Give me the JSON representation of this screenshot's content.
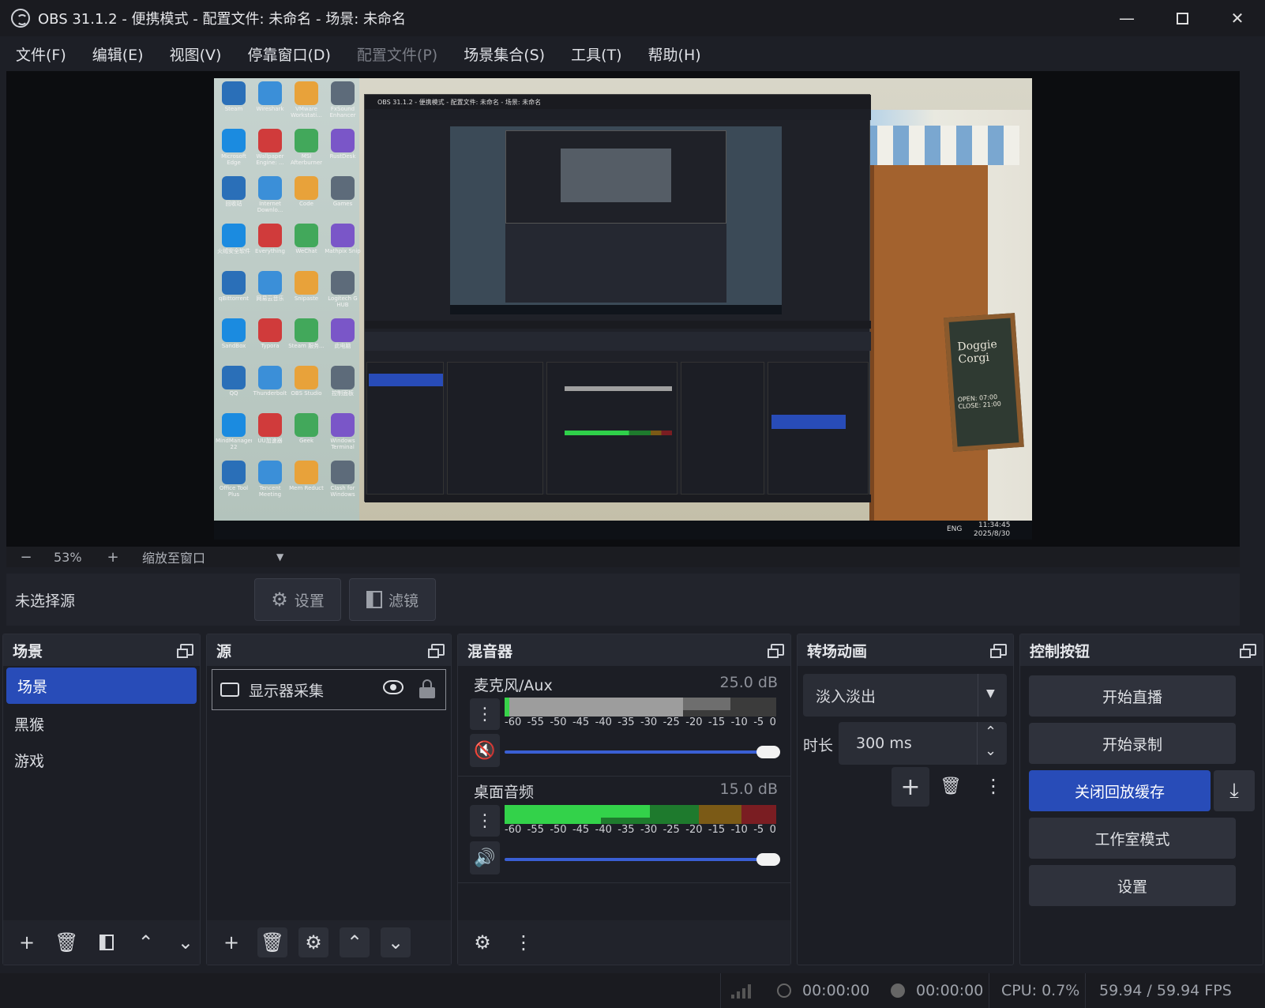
{
  "window": {
    "title": "OBS 31.1.2 - 便携模式 - 配置文件: 未命名 - 场景: 未命名"
  },
  "menu": [
    {
      "label": "文件(F)",
      "enabled": true
    },
    {
      "label": "编辑(E)",
      "enabled": true
    },
    {
      "label": "视图(V)",
      "enabled": true
    },
    {
      "label": "停靠窗口(D)",
      "enabled": true
    },
    {
      "label": "配置文件(P)",
      "enabled": false
    },
    {
      "label": "场景集合(S)",
      "enabled": true
    },
    {
      "label": "工具(T)",
      "enabled": true
    },
    {
      "label": "帮助(H)",
      "enabled": true
    }
  ],
  "zoom": {
    "minus": "−",
    "value": "53%",
    "plus": "+",
    "mode": "缩放至窗口"
  },
  "context": {
    "no_source": "未选择源",
    "settings_label": "设置",
    "filters_label": "滤镜"
  },
  "scenes": {
    "title": "场景",
    "items": [
      "场景",
      "黑猴",
      "游戏"
    ],
    "selected_index": 0
  },
  "sources": {
    "title": "源",
    "items": [
      {
        "name": "显示器采集",
        "visible": true,
        "locked": true
      }
    ]
  },
  "mixer": {
    "title": "混音器",
    "scale_labels": [
      "-60",
      "-55",
      "-50",
      "-45",
      "-40",
      "-35",
      "-30",
      "-25",
      "-20",
      "-15",
      "-10",
      "-5",
      "0"
    ],
    "channels": [
      {
        "name": "麦克风/Aux",
        "db": "25.0 dB",
        "muted": true,
        "volume_fraction": 1.0
      },
      {
        "name": "桌面音频",
        "db": "15.0 dB",
        "muted": false,
        "volume_fraction": 1.0
      }
    ]
  },
  "transitions": {
    "title": "转场动画",
    "selected": "淡入淡出",
    "duration_label": "时长",
    "duration_value": "300 ms"
  },
  "controls": {
    "title": "控制按钮",
    "start_stream": "开始直播",
    "start_record": "开始录制",
    "replay_buffer": "关闭回放缓存",
    "studio_mode": "工作室模式",
    "settings": "设置"
  },
  "status": {
    "stream_time": "00:00:00",
    "record_time": "00:00:00",
    "cpu": "CPU: 0.7%",
    "fps": "59.94 / 59.94 FPS"
  },
  "preview_capture": {
    "desktop_icons": [
      "Steam",
      "Wireshark",
      "VMware Workstati...",
      "FxSound Enhancer",
      "Microsoft Edge",
      "Wallpaper Engine: ...",
      "MSI Afterburner",
      "RustDesk",
      "回收站",
      "Internet Downlo...",
      "Code",
      "Games",
      "火绒安全软件",
      "Everything",
      "WeChat",
      "Mathpix Snip",
      "qBittorrent",
      "网易云音乐",
      "Snipaste",
      "Logitech G HUB",
      "SandBox",
      "Typora",
      "Steam 服务...",
      "此电脑",
      "QQ",
      "Thunderbolt",
      "OBS Studio",
      "控制面板",
      "MindManager 22",
      "UU加速器",
      "Geek",
      "Windows Terminal",
      "Office Tool Plus",
      "Tencent Meeting",
      "Mem Reduct",
      "Clash for Windows"
    ],
    "clock": "11:34:45",
    "date": "2025/8/30",
    "lang": "ENG",
    "sign_1": "Doggie Corgi",
    "sign_2": "OPEN: 07:00 CLOSE: 21:00"
  }
}
